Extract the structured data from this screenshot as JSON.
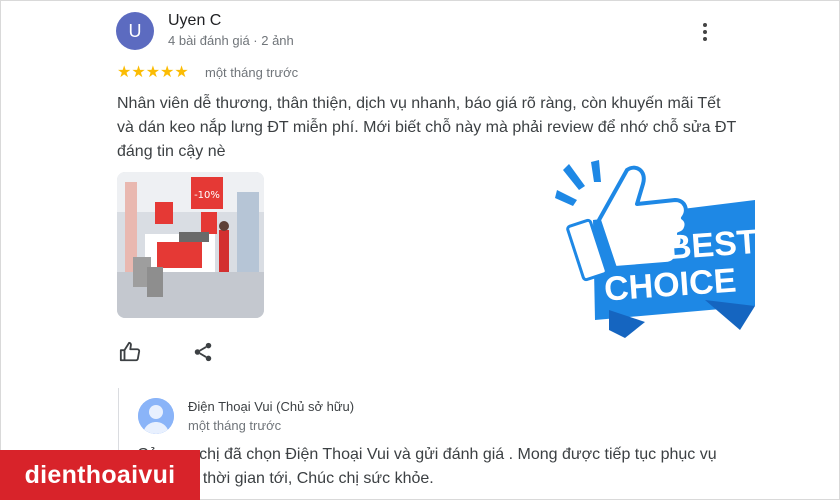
{
  "review": {
    "avatar_initial": "U",
    "author_name": "Uyen C",
    "author_meta": "4 bài đánh giá · 2 ảnh",
    "stars": "★★★★★",
    "rating": 5,
    "time": "một tháng trước",
    "text": "Nhân viên dễ thương, thân thiện, dịch vụ nhanh, báo giá rõ ràng, còn khuyến mãi Tết và dán keo nắp lưng ĐT miễn phí. Mới biết chỗ này mà phải review để nhớ chỗ sửa ĐT đáng tin cậy nè",
    "photo_sign": "-10%"
  },
  "reply": {
    "owner_name": "Điện Thoại Vui (Chủ sở hữu)",
    "time": "một tháng trước",
    "text": "Cảm ơn chị đã chọn Điện Thoại Vui và gửi đánh giá . Mong được tiếp tục phục vụ chị trong thời gian tới, Chúc chị sức khỏe."
  },
  "badge": {
    "line1": "BEST",
    "line2": "CHOICE"
  },
  "brand": {
    "name": "dienthoaivui"
  },
  "colors": {
    "star": "#fbbc04",
    "avatar": "#5c6bc0",
    "badge_blue": "#1e88e5",
    "brand_red": "#d8232a"
  }
}
